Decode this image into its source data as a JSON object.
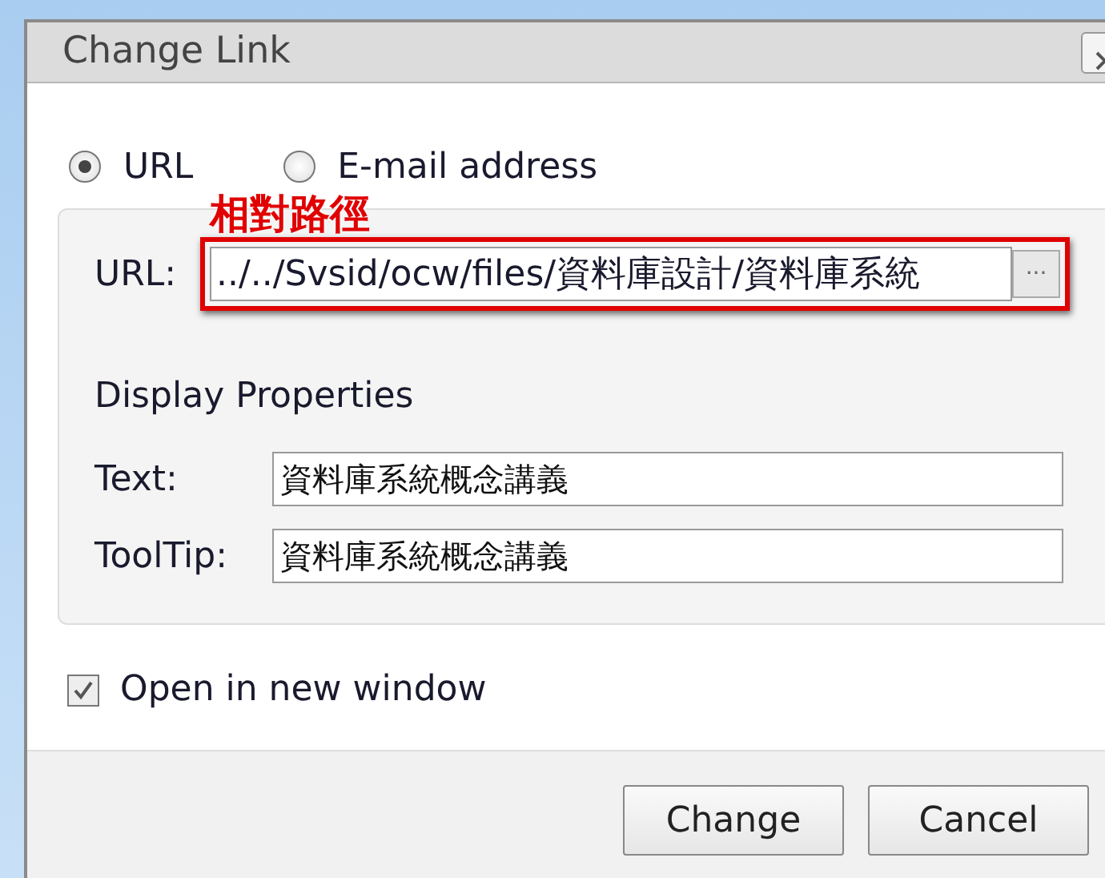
{
  "window": {
    "title": "Change Link"
  },
  "link_type": [
    {
      "label": "URL",
      "selected": true
    },
    {
      "label": "E-mail address",
      "selected": false
    }
  ],
  "annotation": "相對路徑",
  "url": {
    "label": "URL:",
    "value": "../../Svsid/ocw/files/資料庫設計/資料庫系統",
    "browse": "···"
  },
  "display_properties": {
    "heading": "Display Properties",
    "fields": [
      {
        "label": "Text:",
        "value": "資料庫系統概念講義"
      },
      {
        "label": "ToolTip:",
        "value": "資料庫系統概念講義"
      }
    ]
  },
  "open_in_new_window": {
    "label": "Open in new window",
    "checked": true
  },
  "buttons": [
    "Change",
    "Cancel"
  ]
}
